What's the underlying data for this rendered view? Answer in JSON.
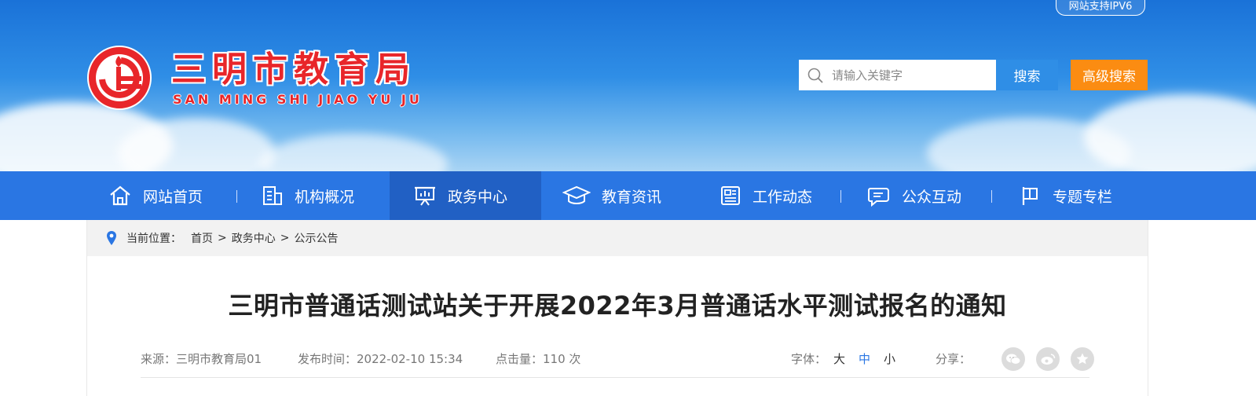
{
  "header": {
    "ipv6_label": "网站支持IPV6",
    "logo_cn": "三明市教育局",
    "logo_en": "SAN MING SHI JIAO YU JU",
    "search_placeholder": "请输入关键字",
    "search_button": "搜索",
    "advanced_search_button": "高级搜索",
    "colors": {
      "brand_red": "#e8262a",
      "search_blue": "#2f8ee6",
      "adv_orange": "#fb8c12"
    }
  },
  "nav": {
    "items": [
      {
        "label": "网站首页",
        "icon": "home-icon"
      },
      {
        "label": "机构概况",
        "icon": "building-icon"
      },
      {
        "label": "政务中心",
        "icon": "presentation-icon",
        "active": true
      },
      {
        "label": "教育资讯",
        "icon": "graduation-cap-icon"
      },
      {
        "label": "工作动态",
        "icon": "newspaper-icon"
      },
      {
        "label": "公众互动",
        "icon": "chat-icon"
      },
      {
        "label": "专题专栏",
        "icon": "flag-icon"
      }
    ],
    "colors": {
      "bg": "#2a76e3",
      "active_bg": "#2160c4"
    }
  },
  "breadcrumb": {
    "prefix": "当前位置：",
    "items": [
      "首页",
      "政务中心",
      "公示公告"
    ],
    "separator": ">"
  },
  "article": {
    "title": "三明市普通话测试站关于开展2022年3月普通话水平测试报名的通知",
    "source": "来源：三明市教育局01",
    "publish_time": "发布时间：2022-02-10 15:34",
    "hits": "点击量：110 次",
    "font_label": "字体：",
    "font_sizes": [
      "大",
      "中",
      "小"
    ],
    "share_label": "分享：",
    "share_icons": [
      "wechat-icon",
      "weibo-icon",
      "favorite-icon"
    ]
  }
}
